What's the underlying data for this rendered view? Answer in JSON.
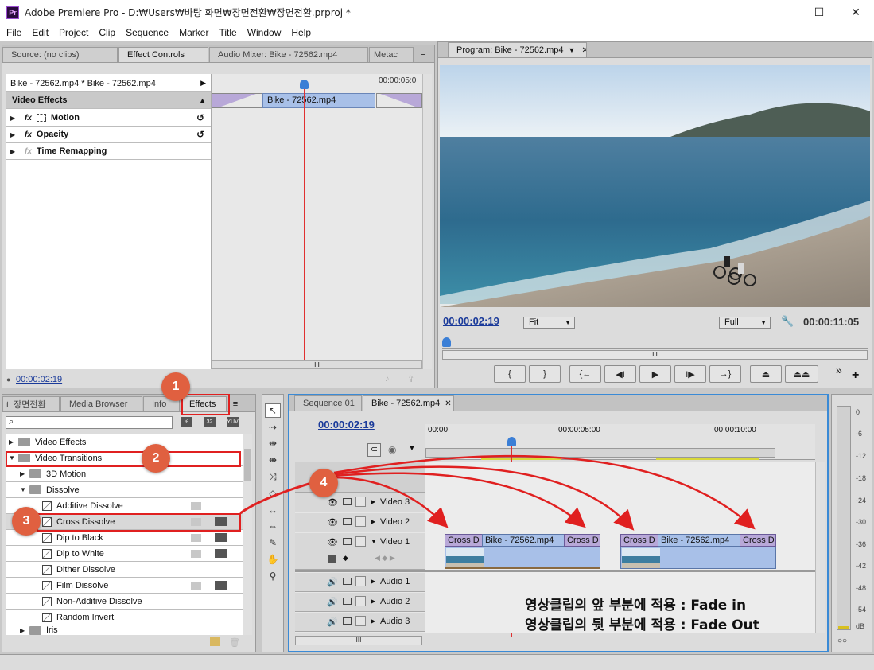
{
  "window": {
    "title": "Adobe Premiere Pro - D:₩Users₩바탕 화면₩장면전환₩장면전환.prproj *",
    "app_icon": "Pr",
    "minimize_glyph": "—",
    "maximize_glyph": "☐",
    "close_glyph": "✕"
  },
  "menu": [
    "File",
    "Edit",
    "Project",
    "Clip",
    "Sequence",
    "Marker",
    "Title",
    "Window",
    "Help"
  ],
  "source_panel": {
    "tabs": [
      "Source: (no clips)",
      "Effect Controls",
      "Audio Mixer: Bike - 72562.mp4",
      "Metac"
    ],
    "clip_path": "Bike - 72562.mp4 * Bike - 72562.mp4",
    "ruler_time": "00:00:05:0",
    "clip_bar_label": "Bike - 72562.mp4",
    "section_title": "Video Effects",
    "effects": [
      {
        "fx": "fx",
        "name": "Motion"
      },
      {
        "fx": "fx",
        "name": "Opacity"
      },
      {
        "fx": "fx",
        "name": "Time Remapping"
      }
    ],
    "timecode": "00:00:02:19",
    "scroll_mark": "III"
  },
  "program_monitor": {
    "tab": "Program: Bike - 72562.mp4",
    "timecode": "00:00:02:19",
    "fit": "Fit",
    "quality": "Full",
    "duration": "00:00:11:05",
    "scroll_mark": "III",
    "buttons": [
      "{",
      "}",
      "{←",
      "◀I",
      "▶",
      "I▶",
      "→}",
      "⏏",
      "⏏⏏"
    ],
    "more": "»",
    "add": "+"
  },
  "project_panel": {
    "tabs": [
      "t: 장면전환",
      "Media Browser",
      "Info",
      "Effects"
    ],
    "badges": [
      "32",
      "YUV"
    ],
    "tree": [
      {
        "label": "Video Effects",
        "level": 0,
        "type": "folder",
        "state": "collapsed"
      },
      {
        "label": "Video Transitions",
        "level": 0,
        "type": "folder",
        "state": "expanded"
      },
      {
        "label": "3D Motion",
        "level": 1,
        "type": "folder",
        "state": "collapsed"
      },
      {
        "label": "Dissolve",
        "level": 1,
        "type": "folder",
        "state": "expanded"
      },
      {
        "label": "Additive Dissolve",
        "level": 2,
        "type": "effect"
      },
      {
        "label": "Cross Dissolve",
        "level": 2,
        "type": "effect"
      },
      {
        "label": "Dip to Black",
        "level": 2,
        "type": "effect"
      },
      {
        "label": "Dip to White",
        "level": 2,
        "type": "effect"
      },
      {
        "label": "Dither Dissolve",
        "level": 2,
        "type": "effect"
      },
      {
        "label": "Film Dissolve",
        "level": 2,
        "type": "effect"
      },
      {
        "label": "Non-Additive Dissolve",
        "level": 2,
        "type": "effect"
      },
      {
        "label": "Random Invert",
        "level": 2,
        "type": "effect"
      },
      {
        "label": "Iris",
        "level": 1,
        "type": "folder",
        "state": "collapsed"
      }
    ]
  },
  "timeline": {
    "tabs": [
      "Sequence 01",
      "Bike - 72562.mp4"
    ],
    "timecode": "00:00:02:19",
    "ruler": [
      "00:00",
      "00:00:05:00",
      "00:00:10:00"
    ],
    "tracks": [
      "Video 3",
      "Video 2",
      "Video 1",
      "Audio 1",
      "Audio 2",
      "Audio 3"
    ],
    "clips": [
      "Cross D",
      "Bike - 72562.mp4",
      "Cross D",
      "Cross D",
      "Bike - 72562.mp4",
      "Cross D"
    ],
    "scroll_mark": "III"
  },
  "annotations": {
    "circles": [
      "1",
      "2",
      "3",
      "4"
    ],
    "line1": "영상클립의 앞 부분에 적용 : Fade in",
    "line2": "영상클립의 뒷 부분에 적용 : Fade Out"
  },
  "vu_meter": {
    "ticks": [
      "0",
      "-6",
      "-12",
      "-18",
      "-24",
      "-30",
      "-36",
      "-42",
      "-48",
      "-54",
      "dB"
    ],
    "bottom": "○○"
  },
  "colors": {
    "annotation_red": "#e02020",
    "circle_fill": "#e06040",
    "playhead": "#e03030",
    "timecode_blue": "#1a3a9a",
    "clip_blue": "#a8c0e8",
    "transition_purple": "#b8a8d8"
  }
}
